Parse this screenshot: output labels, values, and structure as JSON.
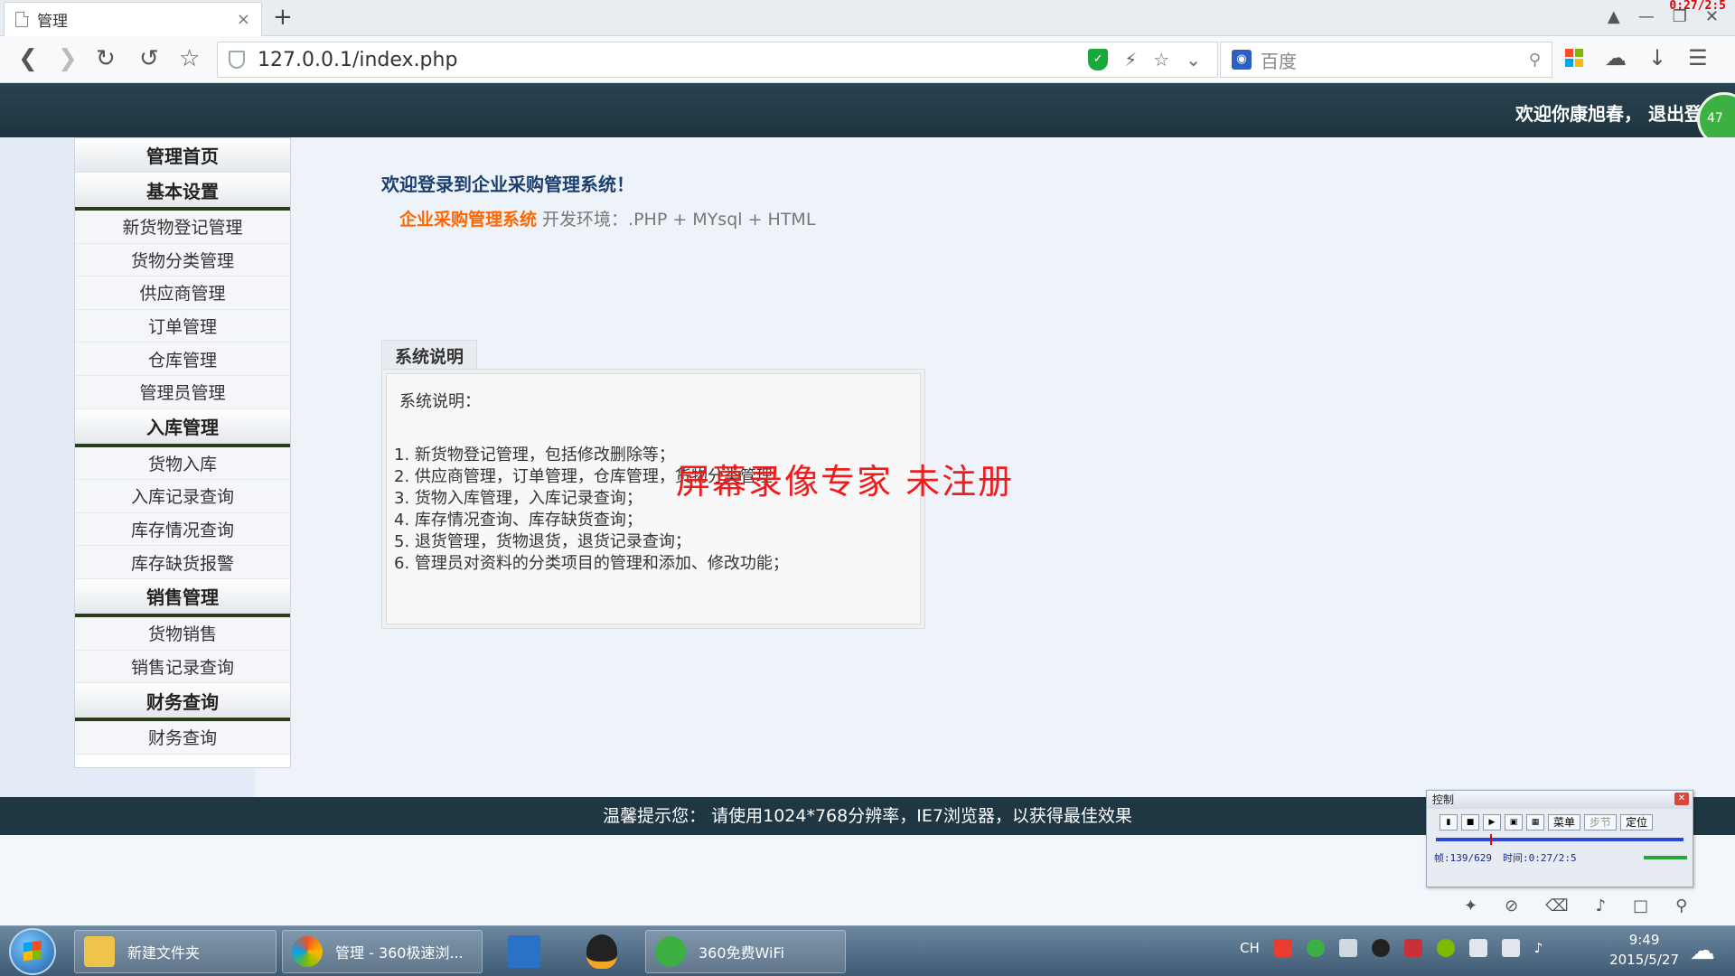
{
  "browser": {
    "tab_title": "管理",
    "tab_close": "×",
    "new_tab": "+",
    "url": "127.0.0.1/index.php",
    "search_engine": "百度",
    "recording_time": "0:27/2:5",
    "icons": [
      "back-icon",
      "forward-icon",
      "reload-icon",
      "undo-icon",
      "star-icon",
      "shield-icon",
      "lightning-icon",
      "dropdown-icon",
      "search-icon",
      "apps-icon",
      "cloud-icon",
      "download-icon",
      "menu-icon"
    ]
  },
  "header": {
    "welcome": "欢迎你康旭春，  退出登陆",
    "badge": "47"
  },
  "sidebar": {
    "sections": [
      {
        "title": "管理首页",
        "items": []
      },
      {
        "title": "基本设置",
        "items": [
          "新货物登记管理",
          "货物分类管理",
          "供应商管理",
          "订单管理",
          "仓库管理",
          "管理员管理"
        ]
      },
      {
        "title": "入库管理",
        "items": [
          "货物入库",
          "入库记录查询",
          "库存情况查询",
          "库存缺货报警"
        ]
      },
      {
        "title": "销售管理",
        "items": [
          "货物销售",
          "销售记录查询"
        ]
      },
      {
        "title": "财务查询",
        "items": [
          "财务查询"
        ]
      }
    ]
  },
  "main": {
    "title": "欢迎登录到企业采购管理系统！",
    "system_name": "企业采购管理系统",
    "env_text": " 开发环境：.PHP + MYsql + HTML",
    "panel_tab": "系统说明",
    "panel_intro": "系统说明：",
    "panel_items": [
      "1. 新货物登记管理，包括修改删除等；",
      "2. 供应商管理，订单管理，仓库管理，货物分类管理",
      "3. 货物入库管理，入库记录查询；",
      "4. 库存情况查询、库存缺货查询；",
      "5. 退货管理，货物退货，退货记录查询；",
      "6. 管理员对资料的分类项目的管理和添加、修改功能；"
    ]
  },
  "watermark": "屏幕录像专家  未注册",
  "footer": {
    "text": "温馨提示您：   请使用1024*768分辨率，IE7浏览器，以获得最佳效果"
  },
  "recorder": {
    "title": "控制",
    "menu_label": "菜单",
    "step_label": "步节",
    "locate_label": "定位",
    "frame_info": "帧:139/629",
    "time_info": "时间:0:27/2:5"
  },
  "taskbar": {
    "items": [
      "新建文件夹",
      "管理 - 360极速浏...",
      "360免费WiFi"
    ],
    "lang": "CH",
    "time": "9:49",
    "date": "2015/5/27"
  }
}
